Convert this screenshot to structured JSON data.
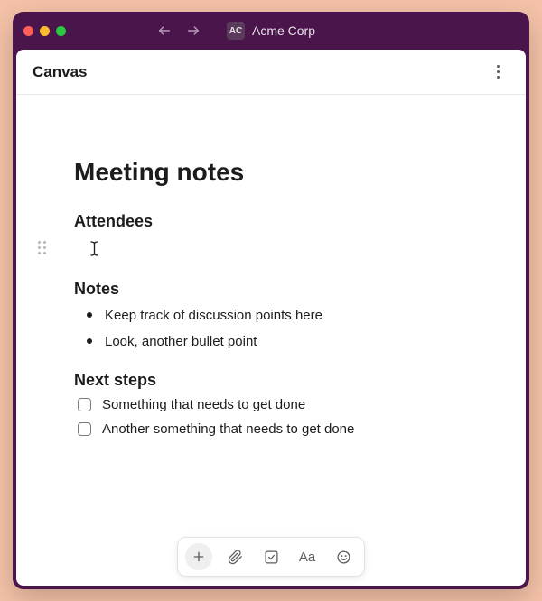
{
  "titlebar": {
    "workspace_initials": "AC",
    "workspace_name": "Acme Corp"
  },
  "header": {
    "title": "Canvas"
  },
  "document": {
    "title": "Meeting notes",
    "sections": {
      "attendees": {
        "heading": "Attendees"
      },
      "notes": {
        "heading": "Notes",
        "bullets": [
          "Keep track of discussion points here",
          "Look, another bullet point"
        ]
      },
      "next_steps": {
        "heading": "Next steps",
        "items": [
          {
            "label": "Something that needs to get done",
            "checked": false
          },
          {
            "label": "Another something that needs to get done",
            "checked": false
          }
        ]
      }
    }
  },
  "toolbar": {
    "add": "add",
    "attach": "attach",
    "checklist": "checklist",
    "format": "Aa",
    "emoji": "emoji"
  }
}
